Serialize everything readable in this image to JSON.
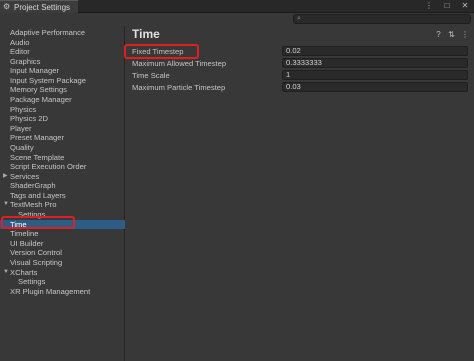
{
  "window": {
    "tab_title": "Project Settings",
    "icons": [
      "gear-icon",
      "more-icon",
      "maximize-icon",
      "close-icon"
    ]
  },
  "search": {
    "placeholder": ""
  },
  "sidebar": {
    "items": [
      {
        "label": "Adaptive Performance",
        "expandable": false
      },
      {
        "label": "Audio",
        "expandable": false
      },
      {
        "label": "Editor",
        "expandable": false
      },
      {
        "label": "Graphics",
        "expandable": false
      },
      {
        "label": "Input Manager",
        "expandable": false
      },
      {
        "label": "Input System Package",
        "expandable": false
      },
      {
        "label": "Memory Settings",
        "expandable": false
      },
      {
        "label": "Package Manager",
        "expandable": false
      },
      {
        "label": "Physics",
        "expandable": false
      },
      {
        "label": "Physics 2D",
        "expandable": false
      },
      {
        "label": "Player",
        "expandable": false
      },
      {
        "label": "Preset Manager",
        "expandable": false
      },
      {
        "label": "Quality",
        "expandable": false
      },
      {
        "label": "Scene Template",
        "expandable": false
      },
      {
        "label": "Script Execution Order",
        "expandable": false
      },
      {
        "label": "Services",
        "expandable": true,
        "caret": "▶"
      },
      {
        "label": "ShaderGraph",
        "expandable": false
      },
      {
        "label": "Tags and Layers",
        "expandable": false
      },
      {
        "label": "TextMesh Pro",
        "expandable": true,
        "caret": "▼"
      },
      {
        "label": "Settings",
        "sub": true
      },
      {
        "label": "Time",
        "selected": true
      },
      {
        "label": "Timeline",
        "expandable": false
      },
      {
        "label": "UI Builder",
        "expandable": false
      },
      {
        "label": "Version Control",
        "expandable": false
      },
      {
        "label": "Visual Scripting",
        "expandable": false
      },
      {
        "label": "XCharts",
        "expandable": true,
        "caret": "▼"
      },
      {
        "label": "Settings",
        "sub": true
      },
      {
        "label": "XR Plugin Management",
        "expandable": false
      }
    ]
  },
  "main": {
    "title": "Time",
    "header_icons": [
      "help-icon",
      "preset-icon",
      "more-icon"
    ],
    "header_glyphs": [
      "?",
      "⇅",
      "⋮"
    ],
    "properties": [
      {
        "label": "Fixed Timestep",
        "value": "0.02"
      },
      {
        "label": "Maximum Allowed Timestep",
        "value": "0.3333333"
      },
      {
        "label": "Time Scale",
        "value": "1"
      },
      {
        "label": "Maximum Particle Timestep",
        "value": "0.03"
      }
    ]
  },
  "colors": {
    "background": "#383838",
    "selection": "#2c5d87",
    "highlight": "#e02020"
  }
}
